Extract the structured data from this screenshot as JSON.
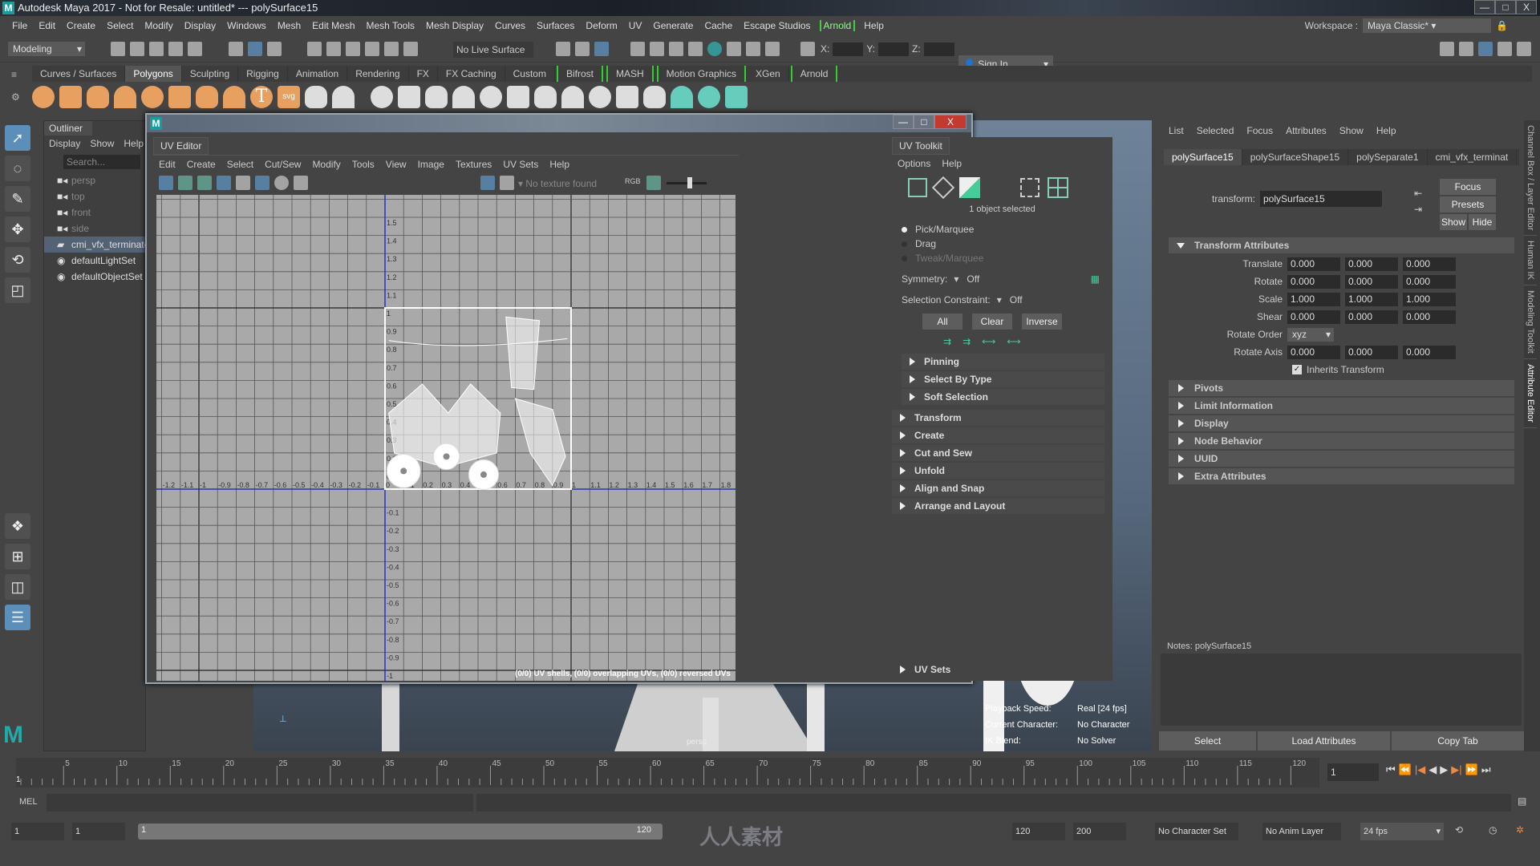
{
  "title": "Autodesk Maya 2017 - Not for Resale: untitled*   ---   polySurface15",
  "window_buttons": [
    "—",
    "□",
    "X"
  ],
  "menu": [
    "File",
    "Edit",
    "Create",
    "Select",
    "Modify",
    "Display",
    "Windows",
    "Mesh",
    "Edit Mesh",
    "Mesh Tools",
    "Mesh Display",
    "Curves",
    "Surfaces",
    "Deform",
    "UV",
    "Generate",
    "Cache",
    "Escape Studios",
    "Arnold",
    "Help"
  ],
  "workspace": {
    "label": "Workspace :",
    "value": "Maya Classic*"
  },
  "status": {
    "mode": "Modeling",
    "live_surface": "No Live Surface",
    "x_label": "X:",
    "y_label": "Y:",
    "z_label": "Z:",
    "sign_in": "Sign In"
  },
  "shelf_tabs": [
    {
      "label": "Curves / Surfaces"
    },
    {
      "label": "Polygons",
      "active": true
    },
    {
      "label": "Sculpting"
    },
    {
      "label": "Rigging"
    },
    {
      "label": "Animation"
    },
    {
      "label": "Rendering"
    },
    {
      "label": "FX"
    },
    {
      "label": "FX Caching"
    },
    {
      "label": "Custom"
    },
    {
      "label": "Bifrost",
      "bracket": true
    },
    {
      "label": "MASH",
      "bracket": true
    },
    {
      "label": "Motion Graphics",
      "bracket": true
    },
    {
      "label": "XGen"
    },
    {
      "label": "Arnold",
      "bracket": true
    }
  ],
  "shelf_icons": [
    "poly-sphere-icon",
    "poly-cube-icon",
    "poly-cylinder-icon",
    "poly-cone-icon",
    "poly-plane-icon",
    "poly-torus-icon",
    "poly-pyramid-icon",
    "poly-pipe-icon",
    "type-icon",
    "svg-icon",
    "combine-icon",
    "separate-icon",
    "mirror-icon",
    "smooth-icon",
    "reduce-icon",
    "cleanup-icon",
    "bevel-icon",
    "bridge-icon",
    "extrude-icon",
    "merge-icon",
    "insert-edge-loop-icon",
    "multi-cut-icon",
    "target-weld-icon",
    "planar-uv-icon",
    "automatic-uv-icon",
    "uv-editor-icon"
  ],
  "outliner": {
    "title": "Outliner",
    "menu": [
      "Display",
      "Show",
      "Help"
    ],
    "search_placeholder": "Search...",
    "items": [
      {
        "label": "persp",
        "dim": true,
        "icon": "camera-icon"
      },
      {
        "label": "top",
        "dim": true,
        "icon": "camera-icon"
      },
      {
        "label": "front",
        "dim": true,
        "icon": "camera-icon"
      },
      {
        "label": "side",
        "dim": true,
        "icon": "camera-icon"
      },
      {
        "label": "cmi_vfx_terminator",
        "selected": true,
        "icon": "mesh-group-icon"
      },
      {
        "label": "defaultLightSet",
        "icon": "set-icon"
      },
      {
        "label": "defaultObjectSet",
        "icon": "set-icon"
      }
    ]
  },
  "uv_editor": {
    "tab": "UV Editor",
    "menu": [
      "Edit",
      "Create",
      "Select",
      "Cut/Sew",
      "Modify",
      "Tools",
      "View",
      "Image",
      "Textures",
      "UV Sets",
      "Help"
    ],
    "texture": "No texture found",
    "rgb": "RGB",
    "u_range": [
      -1.3,
      1.8
    ],
    "v_range": [
      -1.0,
      1.5
    ],
    "status": "(0/0) UV shells, (0/0) overlapping UVs, (0/0) reversed UVs"
  },
  "uv_toolkit": {
    "tab": "UV Toolkit",
    "menu": [
      "Options",
      "Help"
    ],
    "selected_text": "1 object selected",
    "modes": [
      {
        "label": "Pick/Marquee",
        "on": true
      },
      {
        "label": "Drag",
        "on": false
      },
      {
        "label": "Tweak/Marquee",
        "on": false,
        "disabled": true
      }
    ],
    "symmetry_label": "Symmetry:",
    "symmetry_value": "Off",
    "constraint_label": "Selection Constraint:",
    "constraint_value": "Off",
    "buttons": [
      "All",
      "Clear",
      "Inverse"
    ],
    "sub_sections": [
      "Pinning",
      "Select By Type",
      "Soft Selection"
    ],
    "sections": [
      "Transform",
      "Create",
      "Cut and Sew",
      "Unfold",
      "Align and Snap",
      "Arrange and Layout"
    ],
    "uv_sets": "UV Sets"
  },
  "hud": [
    {
      "k": "Playback Speed:",
      "v": "Real [24 fps]"
    },
    {
      "k": "Current Character:",
      "v": "No Character"
    },
    {
      "k": "IK Blend:",
      "v": "No Solver"
    }
  ],
  "viewport_label": "persp",
  "attribute_editor": {
    "menu": [
      "List",
      "Selected",
      "Focus",
      "Attributes",
      "Show",
      "Help"
    ],
    "tabs": [
      "polySurface15",
      "polySurfaceShape15",
      "polySeparate1",
      "cmi_vfx_terminat"
    ],
    "transform_label": "transform:",
    "transform_value": "polySurface15",
    "side_buttons": [
      "Focus",
      "Presets",
      "Show",
      "Hide"
    ],
    "section": "Transform Attributes",
    "rows": [
      {
        "label": "Translate",
        "values": [
          "0.000",
          "0.000",
          "0.000"
        ]
      },
      {
        "label": "Rotate",
        "values": [
          "0.000",
          "0.000",
          "0.000"
        ]
      },
      {
        "label": "Scale",
        "values": [
          "1.000",
          "1.000",
          "1.000"
        ]
      },
      {
        "label": "Shear",
        "values": [
          "0.000",
          "0.000",
          "0.000"
        ]
      }
    ],
    "rotate_order_label": "Rotate Order",
    "rotate_order": "xyz",
    "rotate_axis": {
      "label": "Rotate Axis",
      "values": [
        "0.000",
        "0.000",
        "0.000"
      ]
    },
    "inherits": "Inherits Transform",
    "collapsed": [
      "Pivots",
      "Limit Information",
      "Display",
      "Node Behavior",
      "UUID",
      "Extra Attributes"
    ],
    "notes": "Notes:  polySurface15",
    "bottom_buttons": [
      "Select",
      "Load Attributes",
      "Copy Tab"
    ]
  },
  "side_tabs": [
    "Channel Box / Layer Editor",
    "Human IK",
    "Modeling Toolkit",
    "Attribute Editor"
  ],
  "timeline": {
    "ticks": [
      "5",
      "10",
      "15",
      "20",
      "25",
      "30",
      "35",
      "40",
      "45",
      "50",
      "55",
      "60",
      "65",
      "70",
      "75",
      "80",
      "85",
      "90",
      "95",
      "100",
      "105",
      "110",
      "115",
      "120"
    ],
    "current": "1",
    "current_field": "1"
  },
  "mel": "MEL",
  "range": {
    "start": "1",
    "playback_start": "1",
    "slider_start": "1",
    "slider_end": "120",
    "playback_end": "120",
    "end": "200",
    "character_set": "No Character Set",
    "anim_layer": "No Anim Layer",
    "fps": "24 fps"
  },
  "watermark": "人人素材",
  "colors": {
    "accent": "#5b8fb9",
    "shelf_orange": "#e8a060",
    "uv_axis": "#2233cc",
    "grid": "#a9a9a9"
  }
}
